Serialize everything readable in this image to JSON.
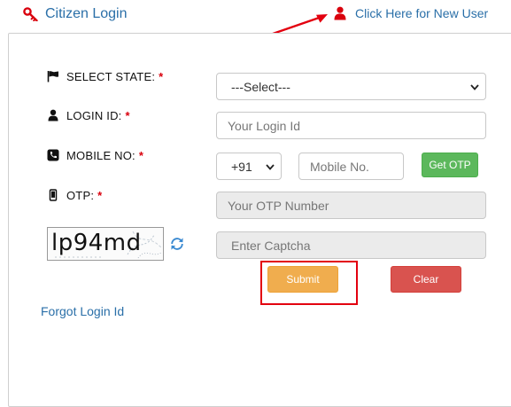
{
  "header": {
    "title": "Citizen Login",
    "new_user_link": "Click Here for New User"
  },
  "form": {
    "state": {
      "label": "SELECT STATE:",
      "required": "*",
      "selected": "---Select---"
    },
    "login_id": {
      "label": "LOGIN ID:",
      "required": "*",
      "placeholder": "Your Login Id"
    },
    "mobile": {
      "label": "MOBILE NO:",
      "required": "*",
      "country_code": "+91",
      "placeholder": "Mobile No.",
      "otp_button": "Get OTP"
    },
    "otp": {
      "label": "OTP:",
      "required": "*",
      "placeholder": "Your OTP Number"
    },
    "captcha": {
      "text": "lp94md",
      "placeholder": "Enter Captcha"
    },
    "submit_button": "Submit",
    "clear_button": "Clear",
    "forgot_link": "Forgot Login Id"
  },
  "colors": {
    "link_blue": "#2a6fa8",
    "required_red": "#d9000d",
    "annotation_red": "#e3000f",
    "success_green": "#5cb85c",
    "warning_orange": "#f0ad4e",
    "danger_red": "#d9534f"
  },
  "icons": {
    "title": "key-icon",
    "new_user": "user-icon",
    "state": "flag-icon",
    "login_id": "user-icon",
    "mobile": "phone-icon",
    "otp": "mobile-icon",
    "captcha_refresh": "refresh-icon"
  }
}
